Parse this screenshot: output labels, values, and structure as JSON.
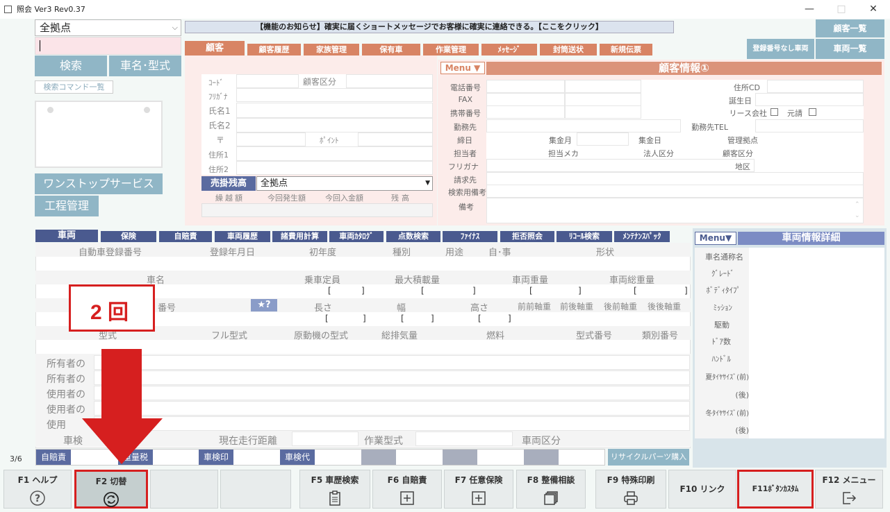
{
  "window": {
    "title": "照会 Ver3 Rev0.37",
    "min": "—",
    "max": "□",
    "close": "✕"
  },
  "left": {
    "store_select": "全拠点",
    "search_btn": "検索",
    "car_btn": "車名･型式",
    "cmd_list": "検索コマンド一覧",
    "onestop": "ワンストップサービス",
    "process": "工程管理",
    "page_counter": "3/6"
  },
  "notice": "【機能のお知らせ】確実に届くショートメッセージでお客様に確実に連絡できる。【ここをクリック】",
  "right_buttons": {
    "customer_list": "顧客一覧",
    "no_reg": "登録番号なし車両",
    "vehicle_list": "車両一覧"
  },
  "customer_tabs": [
    "顧客",
    "顧客履歴",
    "家族管理",
    "保有車",
    "作業管理",
    "ﾒｯｾｰｼﾞ",
    "封筒送状",
    "新規伝票"
  ],
  "customer_form": {
    "code": "ｺｰﾄﾞ",
    "category": "顧客区分",
    "kana": "ﾌﾘｶﾞﾅ",
    "name1": "氏名1",
    "name2": "氏名2",
    "zip": "〒",
    "point": "ﾎﾟｲﾝﾄ",
    "addr1": "住所1",
    "addr2": "住所2"
  },
  "receivable": {
    "label": "売掛残高",
    "store": "全拠点",
    "cols": [
      "繰越額",
      "今回発生額",
      "今回入金額",
      "残高"
    ]
  },
  "customer_info": {
    "menu": "Menu ▼",
    "title": "顧客情報①",
    "phone": "電話番号",
    "fax": "FAX",
    "mobile": "携帯番号",
    "work": "勤務先",
    "closing": "締日",
    "rep": "担当者",
    "kana": "フリガナ",
    "bill": "請求先",
    "search_note": "検索用備考",
    "note": "備考",
    "addr_cd": "住所CD",
    "birthday": "誕生日",
    "lease": "リース会社",
    "moto": "元請",
    "work_tel": "勤務先TEL",
    "collect_month": "集金月",
    "collect_day": "集金日",
    "base": "管理拠点",
    "maker": "担当メカ",
    "corp": "法人区分",
    "cust_cat": "顧客区分",
    "area": "地区"
  },
  "vehicle_tabs": [
    "車両",
    "保険",
    "自賠責",
    "車両履歴",
    "諸費用計算",
    "車両ｶﾀﾛｸﾞ",
    "点数検索",
    "ﾌｧｲﾅｽ",
    "拒否照会",
    "ﾘｺｰﾙ検索",
    "ﾒﾝﾃﾅﾝｽﾊﾟｯｸ"
  ],
  "vehicle": {
    "reg_no": "自動車登録番号",
    "reg_date": "登録年月日",
    "first_year": "初年度",
    "kind": "種別",
    "use": "用途",
    "self_biz": "自･事",
    "shape": "形状",
    "car_name": "車名",
    "capacity": "乗車定員",
    "max_load": "最大積載量",
    "weight": "車両重量",
    "gross_weight": "車両総重量",
    "chassis": "番号",
    "length": "長さ",
    "width": "幅",
    "height": "高さ",
    "ff_axle": "前前軸重",
    "fr_axle": "前後軸重",
    "rf_axle": "後前軸重",
    "rr_axle": "後後軸重",
    "model": "型式",
    "full_model": "フル型式",
    "engine": "原動機の型式",
    "displacement": "総排気量",
    "fuel": "燃料",
    "model_no": "型式番号",
    "class_no": "類別番号",
    "owner1": "所有者の",
    "owner2": "所有者の",
    "user1": "使用者の",
    "user2": "使用者の",
    "user3": "使用",
    "inspect": "車検",
    "mileage": "現在走行距離",
    "work_model": "作業型式",
    "vehicle_cat": "車両区分",
    "insurance": "自賠責",
    "weight_tax": "重量税",
    "inspect_stamp": "車検印",
    "inspect_fee": "車検代",
    "recycle": "リサイクルパーツ購入",
    "star": "★?"
  },
  "vehicle_detail": {
    "menu": "Menu▼",
    "title": "車両情報詳細",
    "rows": [
      "車名通称名",
      "ｸﾞﾚｰﾄﾞ",
      "ﾎﾞﾃﾞｨﾀｲﾌﾟ",
      "ﾐｯｼｮﾝ",
      "駆動",
      "ﾄﾞｱ数",
      "ﾊﾝﾄﾞﾙ",
      "夏ﾀｲﾔｻｲｽﾞ(前)",
      "(後)",
      "冬ﾀｲﾔｻｲｽﾞ(前)",
      "(後)"
    ]
  },
  "annotation": {
    "text": "2 回",
    "color": "#d61f1f"
  },
  "fkeys": [
    {
      "label": "F1 ヘルプ",
      "icon": "help-icon"
    },
    {
      "label": "F2 切替",
      "icon": "switch-icon"
    },
    {
      "label": "",
      "icon": ""
    },
    {
      "label": "",
      "icon": ""
    },
    {
      "label": "F5 車歴検索",
      "icon": "clipboard-icon"
    },
    {
      "label": "F6 自賠責",
      "icon": "plus-box-icon"
    },
    {
      "label": "F7 任意保険",
      "icon": "plus-box-icon"
    },
    {
      "label": "F8 整備相談",
      "icon": "stack-icon"
    },
    {
      "label": "F9 特殊印刷",
      "icon": "printer-icon"
    },
    {
      "label": "F10 リンク",
      "icon": ""
    },
    {
      "label": "F11ﾎﾞﾀﾝｶｽﾀﾑ",
      "icon": ""
    },
    {
      "label": "F12 メニュー",
      "icon": "exit-icon"
    }
  ]
}
